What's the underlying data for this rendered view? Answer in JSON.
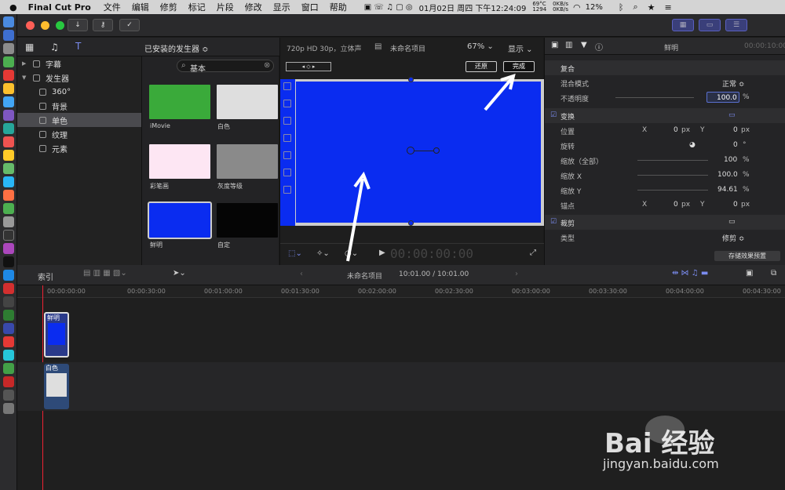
{
  "menubar": {
    "app": "Final Cut Pro",
    "items": [
      "文件",
      "编辑",
      "修剪",
      "标记",
      "片段",
      "修改",
      "显示",
      "窗口",
      "帮助"
    ],
    "date": "01月02日 周四 下午12:24:09",
    "battery": "12%",
    "temp": "69°C",
    "rpm": "1294",
    "net_up": "0KB/s",
    "net_down": "0KB/s"
  },
  "library": {
    "header": "已安装的发生器 ≎",
    "items": [
      {
        "label": "字幕",
        "level": 0,
        "arrow": "▶"
      },
      {
        "label": "发生器",
        "level": 0,
        "arrow": "▼"
      },
      {
        "label": "360°",
        "level": 1
      },
      {
        "label": "背景",
        "level": 1
      },
      {
        "label": "单色",
        "level": 1,
        "selected": true
      },
      {
        "label": "纹理",
        "level": 1
      },
      {
        "label": "元素",
        "level": 1
      }
    ]
  },
  "search": {
    "value": "基本"
  },
  "thumbs": [
    {
      "label": "iMovie",
      "color": "#3aaa3a"
    },
    {
      "label": "白色",
      "color": "#dedede"
    },
    {
      "label": "彩笔画",
      "color": "#fde6f3"
    },
    {
      "label": "灰度等级",
      "color": "#8a8a8a"
    },
    {
      "label": "鲜明",
      "color": "#0a2cf0"
    },
    {
      "label": "自定",
      "color": "#050505"
    }
  ],
  "viewer": {
    "format": "720p HD 30p，立体声",
    "project": "未命名项目",
    "zoom": "67% ⌄",
    "display": "显示 ⌄",
    "revert": "还原",
    "done": "完成",
    "timecode": "00:00:00:00",
    "canvas_color": "#0a2cf0"
  },
  "inspector": {
    "title": "鲜明",
    "tc": "00:00:10:00",
    "rows": [
      {
        "t": "section",
        "label": "复合"
      },
      {
        "t": "row",
        "label": "混合模式",
        "value": "正常 ≎"
      },
      {
        "t": "row",
        "label": "不透明度",
        "value": "100.0",
        "unit": "%"
      },
      {
        "t": "check",
        "label": "变换"
      },
      {
        "t": "row",
        "label": "位置",
        "x": "0",
        "y": "0",
        "unit": "px"
      },
      {
        "t": "row",
        "label": "旋转",
        "value": "0",
        "unit": "°"
      },
      {
        "t": "row",
        "label": "缩放（全部）",
        "value": "100",
        "unit": "%"
      },
      {
        "t": "row",
        "label": "缩放 X",
        "value": "100.0",
        "unit": "%"
      },
      {
        "t": "row",
        "label": "缩放 Y",
        "value": "94.61",
        "unit": "%"
      },
      {
        "t": "row",
        "label": "锚点",
        "x": "0",
        "y": "0",
        "unit": "px"
      },
      {
        "t": "check",
        "label": "裁剪"
      },
      {
        "t": "row",
        "label": "类型",
        "value": "修剪 ≎"
      }
    ],
    "save": "存储效果预置"
  },
  "timeline": {
    "index": "索引",
    "project": "未命名项目",
    "duration": "10:01.00 / 10:01.00",
    "ticks": [
      "00:00:00:00",
      "00:00:30:00",
      "00:01:00:00",
      "00:01:30:00",
      "00:02:00:00",
      "00:02:30:00",
      "00:03:00:00",
      "00:03:30:00",
      "00:04:00:00",
      "00:04:30:00"
    ],
    "clips": [
      {
        "label": "鲜明",
        "color": "#0a2cf0"
      },
      {
        "label": "白色",
        "color": "#dedede"
      }
    ]
  },
  "watermark": {
    "text": "Bai 经验",
    "url": "jingyan.baidu.com"
  }
}
